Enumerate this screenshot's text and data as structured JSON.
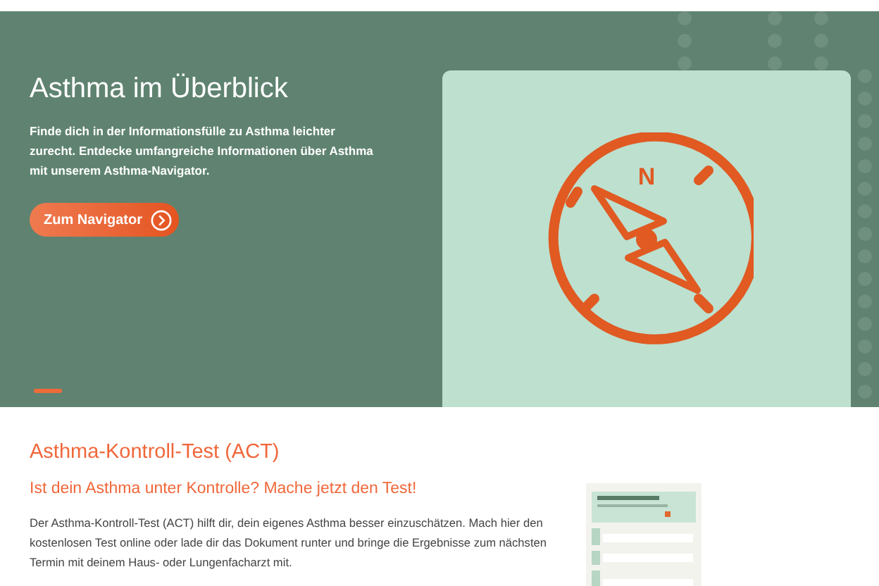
{
  "hero": {
    "title": "Asthma im Überblick",
    "text": "Finde dich in der Informationsfülle zu Asthma leichter zurecht. Entdecke umfangreiche Informationen über Asthma mit unserem Asthma-Navigator.",
    "button": "Zum Navigator",
    "compass_letter": "N"
  },
  "act": {
    "title": "Asthma-Kontroll-Test (ACT)",
    "subtitle": "Ist dein Asthma unter Kontrolle? Mache jetzt den Test!",
    "text": "Der Asthma-Kontroll-Test (ACT) hilft dir, dein eigenes Asthma besser einzuschätzen. Mach hier den kostenlosen Test online oder lade dir das Dokument runter und bringe die Ergebnisse zum nächsten Termin mit deinem Haus- oder Lungenfacharzt mit."
  }
}
